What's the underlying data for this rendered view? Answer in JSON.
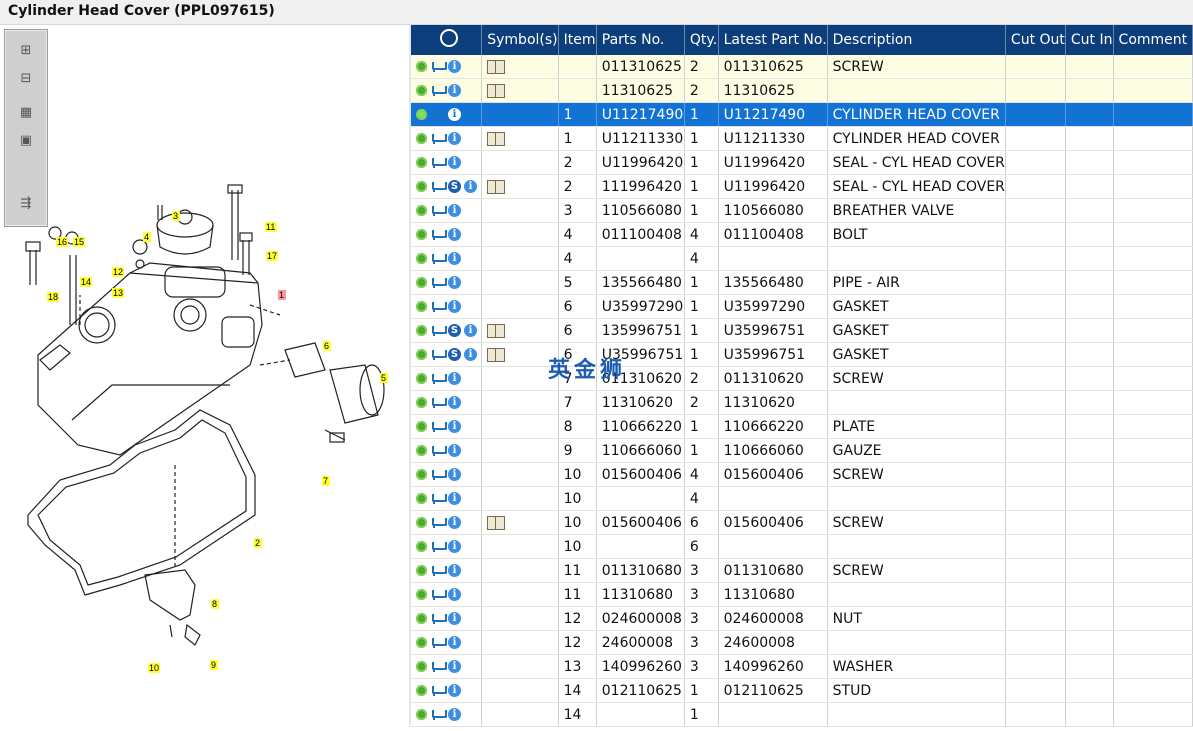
{
  "window": {
    "title": "Cylinder Head Cover (PPL097615)"
  },
  "diagram": {
    "toolbar": {
      "zoom_in_icon": "plus-icon",
      "zoom_out_icon": "minus-icon",
      "fit_icon": "grid-icon",
      "actual_icon": "square-icon",
      "export_icon": "export-icon"
    },
    "callouts": [
      "1",
      "2",
      "3",
      "4",
      "5",
      "6",
      "7",
      "8",
      "9",
      "10",
      "11",
      "12",
      "13",
      "14",
      "15",
      "16",
      "17",
      "18"
    ]
  },
  "grid": {
    "columns": [
      "",
      "Symbol(s)",
      "Item",
      "Parts No.",
      "Qty.",
      "Latest Part No.",
      "Description",
      "Cut Out",
      "Cut In",
      "Comment"
    ],
    "rows": [
      {
        "s": false,
        "sym": true,
        "item": "",
        "part": "011310625",
        "qty": "2",
        "latest": "011310625",
        "desc": "SCREW",
        "hl": true
      },
      {
        "s": false,
        "sym": true,
        "item": "",
        "part": "11310625",
        "qty": "2",
        "latest": "11310625",
        "desc": "",
        "hl": true
      },
      {
        "s": false,
        "sym": false,
        "item": "1",
        "part": "U11217490",
        "qty": "1",
        "latest": "U11217490",
        "desc": "CYLINDER HEAD COVER",
        "sel": true
      },
      {
        "s": false,
        "sym": true,
        "item": "1",
        "part": "U11211330",
        "qty": "1",
        "latest": "U11211330",
        "desc": "CYLINDER HEAD COVER"
      },
      {
        "s": false,
        "sym": false,
        "item": "2",
        "part": "U11996420",
        "qty": "1",
        "latest": "U11996420",
        "desc": "SEAL - CYL HEAD COVER"
      },
      {
        "s": true,
        "sym": true,
        "item": "2",
        "part": "111996420",
        "qty": "1",
        "latest": "U11996420",
        "desc": "SEAL - CYL HEAD COVER"
      },
      {
        "s": false,
        "sym": false,
        "item": "3",
        "part": "110566080",
        "qty": "1",
        "latest": "110566080",
        "desc": "BREATHER VALVE"
      },
      {
        "s": false,
        "sym": false,
        "item": "4",
        "part": "011100408",
        "qty": "4",
        "latest": "011100408",
        "desc": "BOLT"
      },
      {
        "s": false,
        "sym": false,
        "item": "4",
        "part": "",
        "qty": "4",
        "latest": "",
        "desc": ""
      },
      {
        "s": false,
        "sym": false,
        "item": "5",
        "part": "135566480",
        "qty": "1",
        "latest": "135566480",
        "desc": "PIPE - AIR"
      },
      {
        "s": false,
        "sym": false,
        "item": "6",
        "part": "U35997290",
        "qty": "1",
        "latest": "U35997290",
        "desc": "GASKET"
      },
      {
        "s": true,
        "sym": true,
        "item": "6",
        "part": "135996751",
        "qty": "1",
        "latest": "U35996751",
        "desc": "GASKET"
      },
      {
        "s": true,
        "sym": true,
        "item": "6",
        "part": "U35996751",
        "qty": "1",
        "latest": "U35996751",
        "desc": "GASKET"
      },
      {
        "s": false,
        "sym": false,
        "item": "7",
        "part": "011310620",
        "qty": "2",
        "latest": "011310620",
        "desc": "SCREW"
      },
      {
        "s": false,
        "sym": false,
        "item": "7",
        "part": "11310620",
        "qty": "2",
        "latest": "11310620",
        "desc": ""
      },
      {
        "s": false,
        "sym": false,
        "item": "8",
        "part": "110666220",
        "qty": "1",
        "latest": "110666220",
        "desc": "PLATE"
      },
      {
        "s": false,
        "sym": false,
        "item": "9",
        "part": "110666060",
        "qty": "1",
        "latest": "110666060",
        "desc": "GAUZE"
      },
      {
        "s": false,
        "sym": false,
        "item": "10",
        "part": "015600406",
        "qty": "4",
        "latest": "015600406",
        "desc": "SCREW"
      },
      {
        "s": false,
        "sym": false,
        "item": "10",
        "part": "",
        "qty": "4",
        "latest": "",
        "desc": ""
      },
      {
        "s": false,
        "sym": true,
        "item": "10",
        "part": "015600406",
        "qty": "6",
        "latest": "015600406",
        "desc": "SCREW"
      },
      {
        "s": false,
        "sym": false,
        "item": "10",
        "part": "",
        "qty": "6",
        "latest": "",
        "desc": ""
      },
      {
        "s": false,
        "sym": false,
        "item": "11",
        "part": "011310680",
        "qty": "3",
        "latest": "011310680",
        "desc": "SCREW"
      },
      {
        "s": false,
        "sym": false,
        "item": "11",
        "part": "11310680",
        "qty": "3",
        "latest": "11310680",
        "desc": ""
      },
      {
        "s": false,
        "sym": false,
        "item": "12",
        "part": "024600008",
        "qty": "3",
        "latest": "024600008",
        "desc": "NUT"
      },
      {
        "s": false,
        "sym": false,
        "item": "12",
        "part": "24600008",
        "qty": "3",
        "latest": "24600008",
        "desc": ""
      },
      {
        "s": false,
        "sym": false,
        "item": "13",
        "part": "140996260",
        "qty": "3",
        "latest": "140996260",
        "desc": "WASHER"
      },
      {
        "s": false,
        "sym": false,
        "item": "14",
        "part": "012110625",
        "qty": "1",
        "latest": "012110625",
        "desc": "STUD"
      },
      {
        "s": false,
        "sym": false,
        "item": "14",
        "part": "",
        "qty": "1",
        "latest": "",
        "desc": ""
      }
    ]
  },
  "watermark": "英金狮",
  "colors": {
    "header_bg": "#0b3e7a",
    "selected_row": "#1273d4",
    "highlight_row": "#fdfde3",
    "callout": "#ffff33"
  }
}
